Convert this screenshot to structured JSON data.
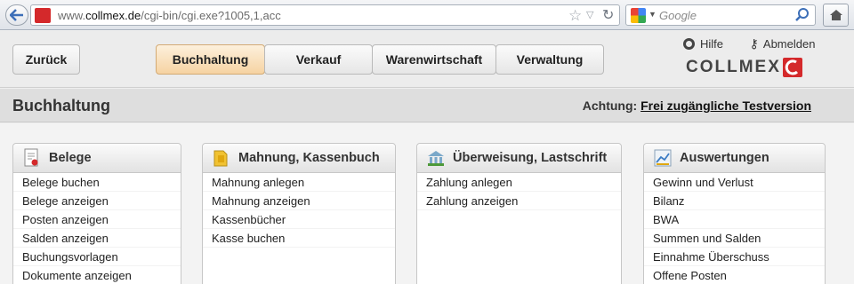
{
  "browser": {
    "url_prefix": "www.",
    "url_domain": "collmex.de",
    "url_path": "/cgi-bin/cgi.exe?1005,1,acc",
    "search_placeholder": "Google"
  },
  "header": {
    "back_label": "Zurück",
    "tabs": [
      {
        "label": "Buchhaltung",
        "active": true
      },
      {
        "label": "Verkauf",
        "active": false
      },
      {
        "label": "Warenwirtschaft",
        "active": false
      },
      {
        "label": "Verwaltung",
        "active": false
      }
    ],
    "help_label": "Hilfe",
    "logout_label": "Abmelden",
    "logo_text": "COLLMEX"
  },
  "title_band": {
    "title": "Buchhaltung",
    "notice_prefix": "Achtung:",
    "notice_link": "Frei zugängliche Testversion"
  },
  "panels": [
    {
      "title": "Belege",
      "icon": "document-certificate-icon",
      "items": [
        "Belege buchen",
        "Belege anzeigen",
        "Posten anzeigen",
        "Salden anzeigen",
        "Buchungsvorlagen",
        "Dokumente anzeigen"
      ]
    },
    {
      "title": "Mahnung, Kassenbuch",
      "icon": "folder-icon",
      "items": [
        "Mahnung anlegen",
        "Mahnung anzeigen",
        "Kassenbücher",
        "Kasse buchen"
      ]
    },
    {
      "title": "Überweisung, Lastschrift",
      "icon": "bank-transfer-icon",
      "items": [
        "Zahlung anlegen",
        "Zahlung anzeigen"
      ]
    },
    {
      "title": "Auswertungen",
      "icon": "report-chart-icon",
      "items": [
        "Gewinn und Verlust",
        "Bilanz",
        "BWA",
        "Summen und Salden",
        "Einnahme Überschuss",
        "Offene Posten"
      ]
    }
  ],
  "colors": {
    "accent_red": "#d4292b",
    "active_tab": "#f6d3a2"
  }
}
